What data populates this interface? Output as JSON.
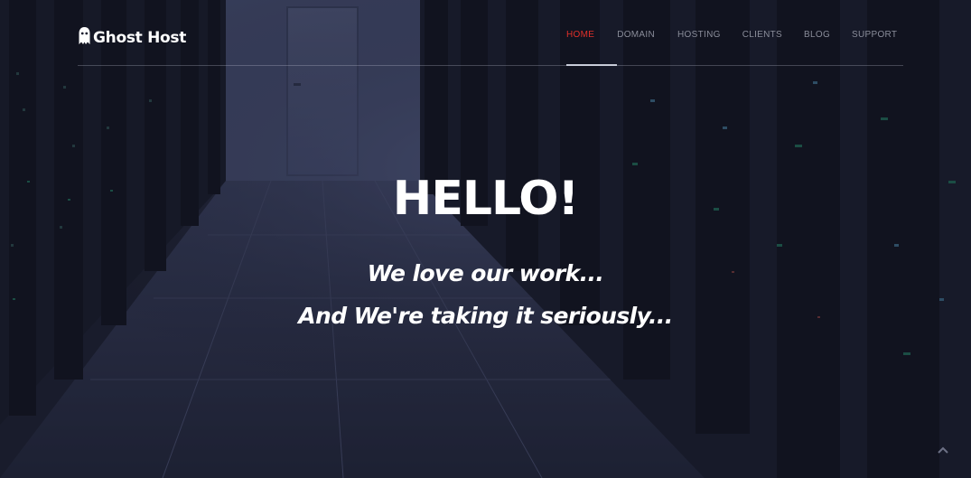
{
  "brand": {
    "name": "Ghost Host",
    "logo_icon": "ghost-icon"
  },
  "nav": {
    "items": [
      {
        "label": "HOME",
        "active": true
      },
      {
        "label": "DOMAIN",
        "active": false
      },
      {
        "label": "HOSTING",
        "active": false
      },
      {
        "label": "CLIENTS",
        "active": false
      },
      {
        "label": "BLOG",
        "active": false
      },
      {
        "label": "SUPPORT",
        "active": false
      }
    ]
  },
  "hero": {
    "headline": "HELLO!",
    "tagline_line1": "We love our work...",
    "tagline_line2": "And We're taking it seriously..."
  },
  "scroll_top_icon": "chevron-up-icon",
  "colors": {
    "accent": "#e0302a",
    "nav_text": "#8a8d9a",
    "background": "#1d2030",
    "text": "#ffffff"
  }
}
